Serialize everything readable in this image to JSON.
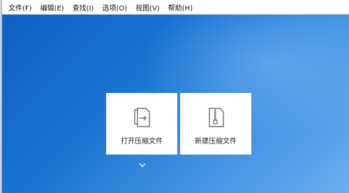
{
  "menubar": {
    "items": [
      "文件(F)",
      "编辑(E)",
      "查找(I)",
      "选项(O)",
      "视图(V)",
      "帮助(H)"
    ]
  },
  "actions": {
    "open_label": "打开压缩文件",
    "new_label": "新建压缩文件"
  },
  "icons": {
    "open": "open-archive-icon",
    "new": "zip-archive-icon",
    "more": "chevron-down-icon"
  },
  "colors": {
    "background_dark": "#0f5fc4",
    "background_light": "#6aaef0",
    "card": "#ffffff"
  }
}
